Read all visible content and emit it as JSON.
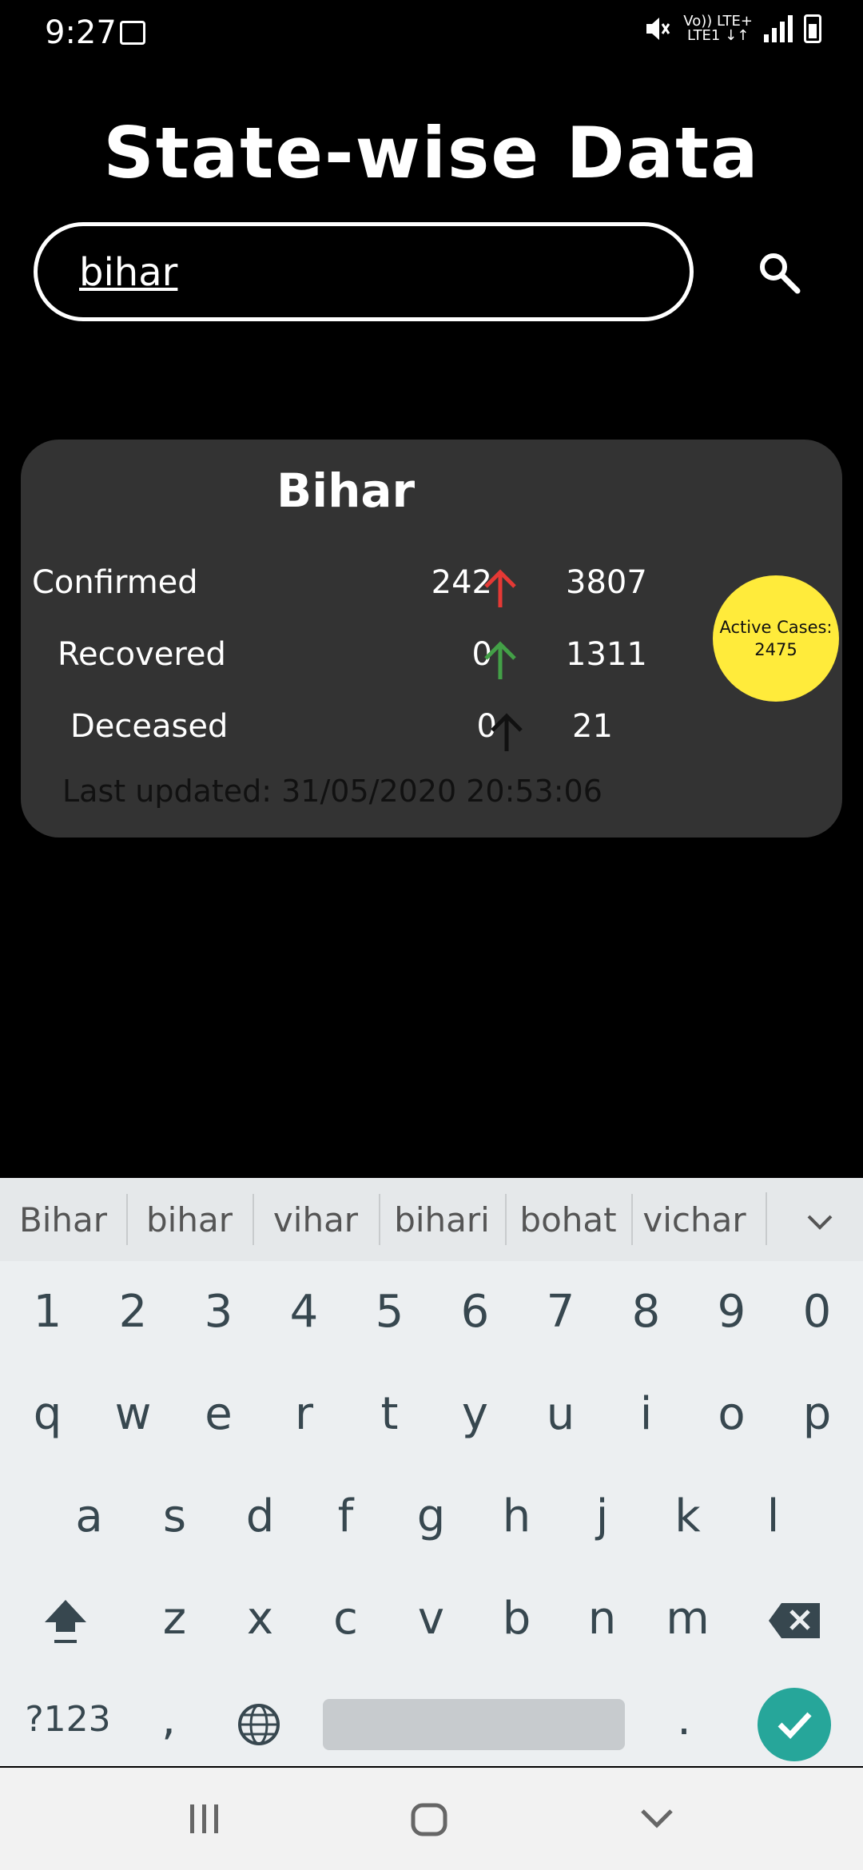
{
  "status_bar": {
    "time": "9:27",
    "network_top": "Vo)) LTE+",
    "network_bottom": "LTE1 ↓↑",
    "icons": [
      "image-icon",
      "mute-icon",
      "signal-icon",
      "battery-charging-icon"
    ]
  },
  "header": {
    "title": "State-wise Data"
  },
  "search": {
    "value": "bihar",
    "icon": "search-icon"
  },
  "card": {
    "state": "Bihar",
    "rows": [
      {
        "label": "Confirmed",
        "delta": "242",
        "total": "3807",
        "arrow_color": "#e53935"
      },
      {
        "label": "Recovered",
        "delta": "0",
        "total": "1311",
        "arrow_color": "#43a047"
      },
      {
        "label": "Deceased",
        "delta": "0",
        "total": "21",
        "arrow_color": "#111111"
      }
    ],
    "active_label": "Active Cases:",
    "active_value": "2475",
    "last_updated": "Last updated: 31/05/2020 20:53:06"
  },
  "keyboard": {
    "suggestions": [
      "Bihar",
      "bihar",
      "vihar",
      "bihari",
      "bohat",
      "vichar"
    ],
    "row_numbers": [
      "1",
      "2",
      "3",
      "4",
      "5",
      "6",
      "7",
      "8",
      "9",
      "0"
    ],
    "row_q": [
      "q",
      "w",
      "e",
      "r",
      "t",
      "y",
      "u",
      "i",
      "o",
      "p"
    ],
    "row_a": [
      "a",
      "s",
      "d",
      "f",
      "g",
      "h",
      "j",
      "k",
      "l"
    ],
    "row_z": [
      "z",
      "x",
      "c",
      "v",
      "b",
      "n",
      "m"
    ],
    "symbols_label": "?123",
    "comma_label": ",",
    "period_label": "."
  },
  "colors": {
    "card_bg": "#333333",
    "active_circle": "#ffeb3b",
    "done_button": "#26a69a"
  }
}
